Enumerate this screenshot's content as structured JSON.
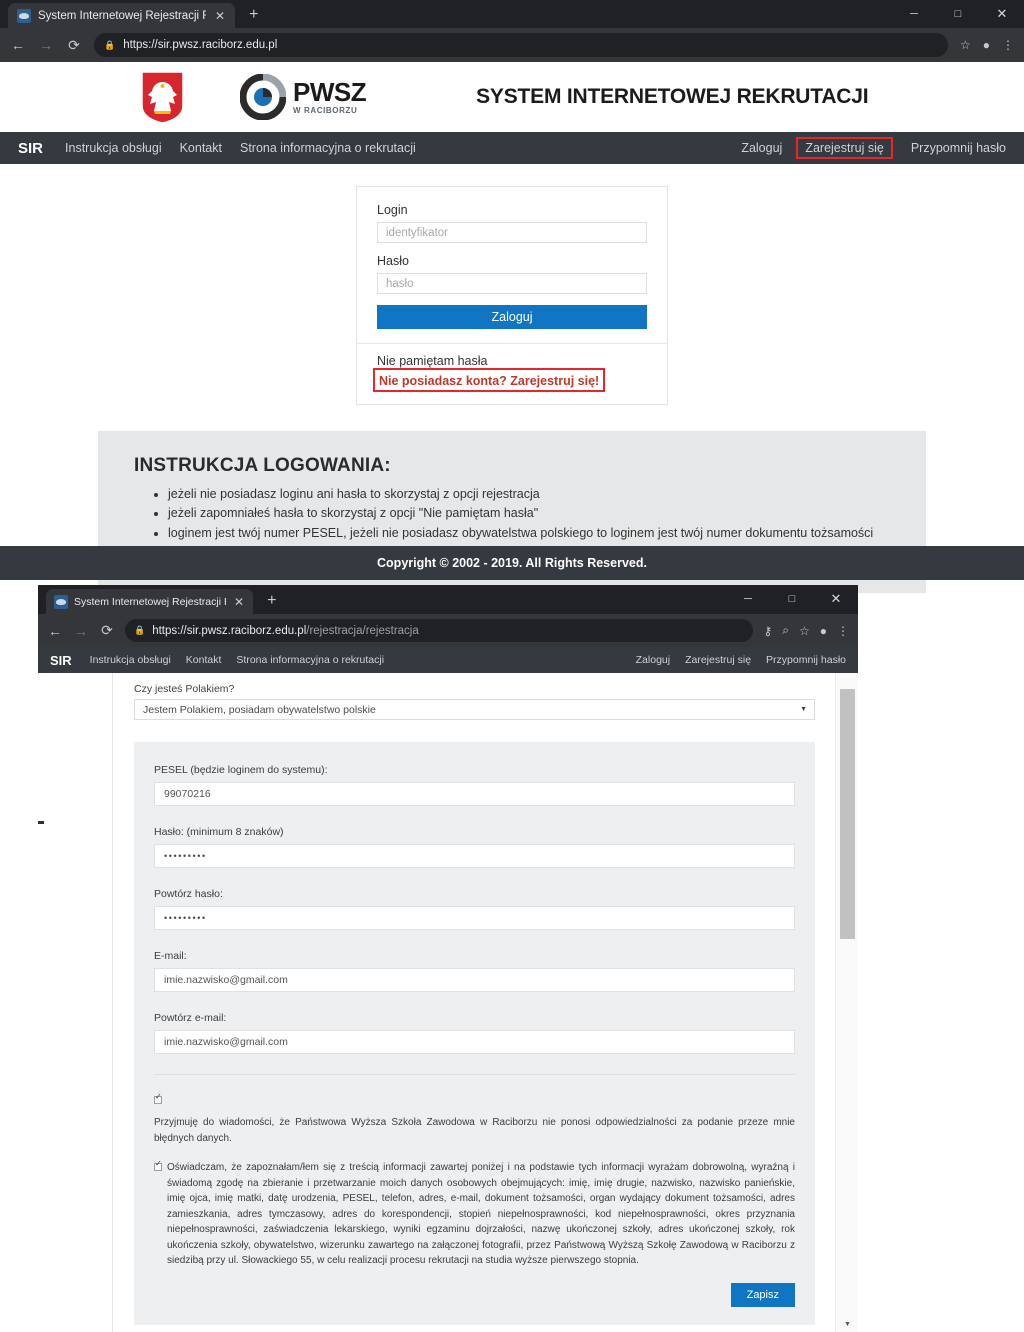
{
  "window1": {
    "browser": {
      "tab_title": "System Internetowej Rejestracji R",
      "tab_close_icon": "close-icon",
      "new_tab_icon": "plus-icon",
      "back_icon": "arrow-left-icon",
      "forward_icon": "arrow-right-icon",
      "reload_icon": "reload-icon",
      "lock_icon": "lock-icon",
      "url": "https://sir.pwsz.raciborz.edu.pl",
      "url_path": "",
      "star_icon": "star-icon",
      "profile_icon": "account-icon",
      "menu_icon": "kebab-menu-icon",
      "minimize_label": "─",
      "maximize_label": "□",
      "close_label": "✕"
    },
    "header": {
      "crest_alt": "polish-eagle-crest",
      "logo_main": "PWSZ",
      "logo_sub": "W RACIBORZU",
      "site_title": "SYSTEM INTERNETOWEJ REKRUTACJI"
    },
    "navbar": {
      "brand": "SIR",
      "left_links": [
        "Instrukcja obsługi",
        "Kontakt",
        "Strona informacyjna o rekrutacji"
      ],
      "right_links": [
        "Zaloguj",
        "Zarejestruj się",
        "Przypomnij hasło"
      ],
      "highlighted_link": "Zarejestruj się",
      "highlight_color": "#e8262a"
    },
    "login_card": {
      "login_label": "Login",
      "login_placeholder": "identyfikator",
      "password_label": "Hasło",
      "password_placeholder": "hasło",
      "submit_label": "Zaloguj",
      "submit_color": "#1076c4",
      "forgot_link": "Nie pamiętam hasła",
      "register_link": "Nie posiadasz konta? Zarejestruj się!"
    },
    "instructions": {
      "title": "INSTRUKCJA LOGOWANIA:",
      "items": [
        "jeżeli nie posiadasz loginu ani hasła to skorzystaj z opcji rejestracja",
        "jeżeli zapomniałeś hasła to skorzystaj z opcji \"Nie pamiętam hasła\"",
        "loginem jest twój numer PESEL, jeżeli nie posiadasz obywatelstwa polskiego to loginem jest twój numer dokumentu tożsamości (podawany podczas zakładania konta)"
      ]
    },
    "footer": {
      "copyright": "Copyright © 2002 - 2019. All Rights Reserved."
    }
  },
  "window2": {
    "browser": {
      "tab_title": "System Internetowej Rejestracji R",
      "tab_close_icon": "close-icon",
      "new_tab_icon": "plus-icon",
      "back_icon": "arrow-left-icon",
      "forward_icon": "arrow-right-icon",
      "reload_icon": "reload-icon",
      "lock_icon": "lock-icon",
      "url": "https://sir.pwsz.raciborz.edu.pl",
      "url_path": "/rejestracja/rejestracja",
      "key_icon": "password-key-icon",
      "zoom_icon": "zoom-search-icon",
      "star_icon": "star-icon",
      "profile_icon": "account-icon",
      "menu_icon": "kebab-menu-icon",
      "minimize_label": "─",
      "maximize_label": "□",
      "close_label": "✕"
    },
    "navbar": {
      "brand": "SIR",
      "left_links": [
        "Instrukcja obsługi",
        "Kontakt",
        "Strona informacyjna o rekrutacji"
      ],
      "right_links": [
        "Zaloguj",
        "Zarejestruj się",
        "Przypomnij hasło"
      ]
    },
    "form": {
      "nationality_label": "Czy jesteś Polakiem?",
      "nationality_value": "Jestem Polakiem, posiadam obywatelstwo polskie",
      "caret_icon": "chevron-down-icon",
      "fields": [
        {
          "label": "PESEL (będzie loginem do systemu):",
          "value": "99070216",
          "type": "text"
        },
        {
          "label": "Hasło: (minimum 8 znaków)",
          "value": "•••••••••",
          "type": "password"
        },
        {
          "label": "Powtórz hasło:",
          "value": "•••••••••",
          "type": "password"
        },
        {
          "label": "E-mail:",
          "value": "imie.nazwisko@gmail.com",
          "type": "email"
        },
        {
          "label": "Powtórz e-mail:",
          "value": "imie.nazwisko@gmail.com",
          "type": "email"
        }
      ],
      "consent1": {
        "checked": true,
        "text": "Przyjmuję do wiadomości, że Państwowa Wyższa Szkoła Zawodowa w Raciborzu nie ponosi odpowiedzialności za podanie przeze mnie błędnych danych."
      },
      "consent2": {
        "checked": true,
        "text": "Oświadczam, że zapoznałam/łem się z treścią informacji zawartej poniżej i na podstawie tych informacji wyrażam dobrowolną, wyraźną i świadomą zgodę na zbieranie i przetwarzanie moich danych osobowych obejmujących: imię, imię drugie, nazwisko, nazwisko panieńskie, imię ojca, imię matki, datę urodzenia, PESEL, telefon, adres, e-mail, dokument tożsamości, organ wydający dokument tożsamości, adres zamieszkania, adres tymczasowy, adres do korespondencji, stopień niepełnosprawności, kod niepełnosprawności, okres przyznania niepełnosprawności, zaświadczenia lekarskiego, wyniki egzaminu dojrzałości, nazwę ukończonej szkoły, adres ukończonej szkoły, rok ukończenia szkoły, obywatelstwo, wizerunku zawartego na załączonej fotografii, przez Państwową Wyższą Szkołę Zawodową w Raciborzu z siedzibą przy ul. Słowackiego 55, w celu realizacji procesu rekrutacji na studia wyższe pierwszego stopnia."
      },
      "submit_label": "Zapisz",
      "submit_color": "#1076c4"
    },
    "scrollbar": {
      "down_arrow_icon": "chevron-down-icon"
    }
  }
}
